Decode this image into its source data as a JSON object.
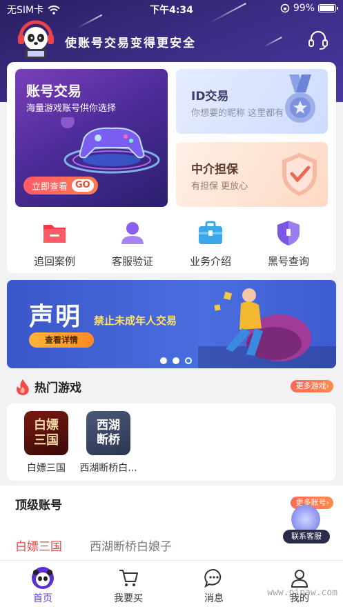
{
  "status_bar": {
    "carrier": "无SIM卡",
    "time": "下午4:34",
    "battery": "99%",
    "battery_level": 0.99
  },
  "header": {
    "slogan": "使账号交易变得更安全"
  },
  "features": {
    "trade": {
      "title": "账号交易",
      "subtitle": "海量游戏账号供你选择",
      "cta": "立即查看",
      "cta_badge": "GO"
    },
    "id_trade": {
      "title": "ID交易",
      "subtitle": "你想要的昵称 这里都有"
    },
    "escrow": {
      "title": "中介担保",
      "subtitle": "有担保 更放心"
    }
  },
  "quick_links": [
    {
      "label": "追回案例",
      "icon": "folder-icon",
      "color": "#ef3b48"
    },
    {
      "label": "客服验证",
      "icon": "user-icon",
      "color": "#8a5cf0"
    },
    {
      "label": "业务介绍",
      "icon": "briefcase-icon",
      "color": "#3aa7ea"
    },
    {
      "label": "黑号查询",
      "icon": "shield-icon",
      "color": "#7a55e6"
    }
  ],
  "banner": {
    "title": "声明",
    "subtitle": "禁止未成年人交易",
    "button": "查看详情",
    "slides": 3,
    "active_slide": 3
  },
  "hot_games": {
    "title": "热门游戏",
    "more": "更多游戏",
    "items": [
      {
        "name": "白嫖三国",
        "icon_text": "白嫖三国"
      },
      {
        "name": "西湖断桥白...",
        "icon_text": "西湖断桥"
      }
    ]
  },
  "top_accounts": {
    "title": "顶级账号",
    "more": "更多账号",
    "tabs": [
      "白嫖三国",
      "西湖断桥白娘子"
    ],
    "active_tab": 0
  },
  "support": {
    "label": "联系客服"
  },
  "tab_bar": [
    {
      "label": "首页",
      "icon": "panda-home-icon",
      "active": true
    },
    {
      "label": "我要买",
      "icon": "cart-icon",
      "active": false
    },
    {
      "label": "消息",
      "icon": "message-icon",
      "active": false
    },
    {
      "label": "我的",
      "icon": "profile-icon",
      "active": false
    }
  ],
  "watermark": "www.pipaw.com"
}
